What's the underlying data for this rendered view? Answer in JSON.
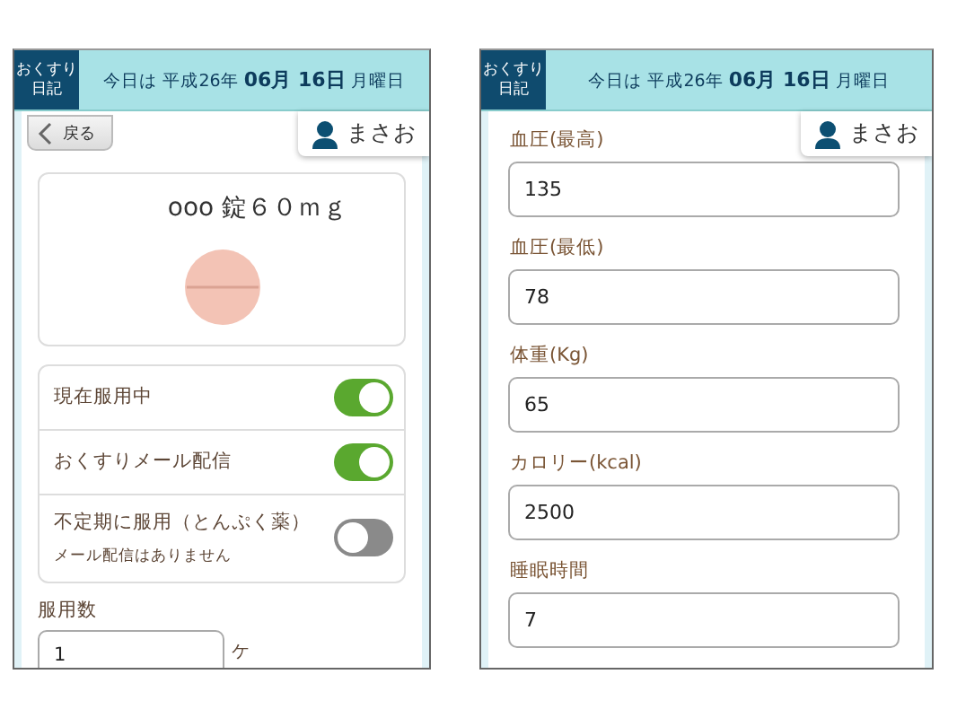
{
  "screens": [
    {
      "kind": "medicine",
      "header": {
        "logo": [
          "おくすり",
          "日記"
        ],
        "date": "今日は 平成26年 **06月 16日** 月曜日"
      },
      "back_button": "戻る",
      "user": "まさお",
      "medicine_name": "ooo 錠６０ｍｇ",
      "toggles": [
        {
          "label": "現在服用中",
          "on": true
        },
        {
          "label": "おくすりメール配信",
          "on": true
        },
        {
          "label": "不定期に服用（とんぷく薬）",
          "note": "メール配信はありません",
          "on": false
        }
      ],
      "dose": {
        "label": "服用数",
        "value": "1",
        "unit": "ケ"
      }
    },
    {
      "kind": "vitals",
      "header": {
        "logo": [
          "おくすり",
          "日記"
        ],
        "date": "今日は 平成26年 **06月 16日** 月曜日"
      },
      "user": "まさお",
      "fields": [
        {
          "label": "血圧(最高)",
          "value": "135"
        },
        {
          "label": "血圧(最低)",
          "value": "78"
        },
        {
          "label": "体重(Kg)",
          "value": "65"
        },
        {
          "label": "カロリー(kcal)",
          "value": "2500"
        },
        {
          "label": "睡眠時間",
          "value": "7"
        }
      ]
    }
  ]
}
